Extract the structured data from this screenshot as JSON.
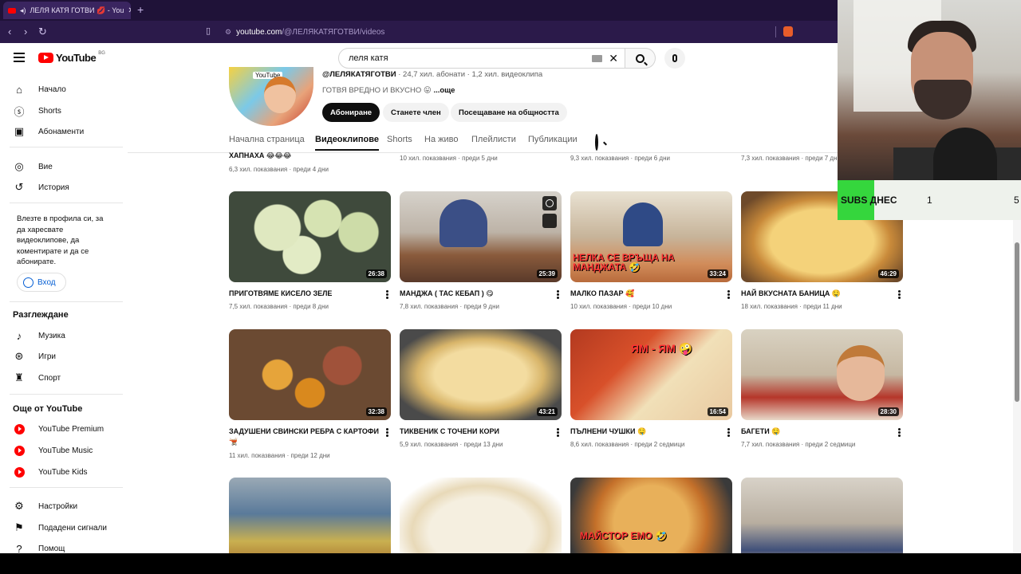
{
  "browser": {
    "tab_title": "ЛЕЛЯ КАТЯ ГОТВИ 💋 - You",
    "url_host": "youtube.com",
    "url_path": "/@ЛЕЛЯКАТЯГОТВИ/videos"
  },
  "masthead": {
    "logo_text": "YouTube",
    "country_code": "BG",
    "search_value": "леля катя"
  },
  "sidebar": {
    "main_items": [
      {
        "label": "Начало",
        "icon": "home-icon"
      },
      {
        "label": "Shorts",
        "icon": "shorts-icon"
      },
      {
        "label": "Абонаменти",
        "icon": "subscriptions-icon"
      }
    ],
    "you_items": [
      {
        "label": "Вие",
        "icon": "user-icon"
      },
      {
        "label": "История",
        "icon": "history-icon"
      }
    ],
    "signin_text": "Влезте в профила си, за да харесвате видеоклипове, да коментирате и да се абонирате.",
    "signin_button": "Вход",
    "explore_heading": "Разглеждане",
    "explore_items": [
      {
        "label": "Музика",
        "icon": "music-icon"
      },
      {
        "label": "Игри",
        "icon": "gaming-icon"
      },
      {
        "label": "Спорт",
        "icon": "trophy-icon"
      }
    ],
    "more_heading": "Още от YouTube",
    "more_items": [
      {
        "label": "YouTube Premium"
      },
      {
        "label": "YouTube Music"
      },
      {
        "label": "YouTube Kids"
      }
    ],
    "bottom_items": [
      {
        "label": "Настройки",
        "icon": "gear-icon"
      },
      {
        "label": "Подадени сигнали",
        "icon": "flag-icon"
      },
      {
        "label": "Помощ",
        "icon": "help-icon"
      }
    ]
  },
  "channel": {
    "avatar_label": "YouTube",
    "handle": "@ЛЕЛЯКАТЯГОТВИ",
    "stats": " · 24,7 хил. абонати · 1,2 хил. видеоклипа",
    "description": "ГОТВЯ ВРЕДНО И ВКУСНО 😛 ",
    "more": "...още",
    "subscribe": "Абониране",
    "join": "Станете член",
    "community": "Посещаване на общността",
    "tabs": [
      "Начална страница",
      "Видеоклипове",
      "Shorts",
      "На живо",
      "Плейлисти",
      "Публикации"
    ]
  },
  "previous_row": [
    {
      "title": "ХАПНАХА 😂😂😂",
      "meta": "6,3 хил. показвания · преди 4 дни"
    },
    {
      "meta": "10 хил. показвания · преди 5 дни"
    },
    {
      "meta": "9,3 хил. показвания · преди 6 дни"
    },
    {
      "meta": "7,3 хил. показвания · преди 7 дни"
    }
  ],
  "videos": [
    {
      "title": "ПРИГОТВЯМЕ КИСЕЛО ЗЕЛЕ",
      "meta": "7,5 хил. показвания · преди 8 дни",
      "duration": "26:38"
    },
    {
      "title": "МАНДЖА ( ТАС КЕБАП ) 😋",
      "meta": "7,8 хил. показвания · преди 9 дни",
      "duration": "25:39"
    },
    {
      "title": "МАЛКО ПАЗАР 🥰",
      "meta": "10 хил. показвания · преди 10 дни",
      "duration": "33:24",
      "overlay": "НЕЛКА СЕ ВРЪЩА НА МАНДЖАТА 🤣"
    },
    {
      "title": "НАЙ ВКУСНАТА БАНИЦА 🤤",
      "meta": "18 хил. показвания · преди 11 дни",
      "duration": "46:29"
    },
    {
      "title": "ЗАДУШЕНИ СВИНСКИ РЕБРА С КАРТОФИ 🫕",
      "meta": "11 хил. показвания · преди 12 дни",
      "duration": "32:38"
    },
    {
      "title": "ТИКВЕНИК С ТОЧЕНИ КОРИ",
      "meta": "5,9 хил. показвания · преди 13 дни",
      "duration": "43:21"
    },
    {
      "title": "ПЪЛНЕНИ ЧУШКИ 🤤",
      "meta": "8,6 хил. показвания · преди 2 седмици",
      "duration": "16:54",
      "overlay": "ЯМ - ЯМ 🤪"
    },
    {
      "title": "БАГЕТИ 🤤",
      "meta": "7,7 хил. показвания · преди 2 седмици",
      "duration": "28:30"
    },
    {
      "overlay": "МАЙСТОР ЕМО 🤣"
    }
  ],
  "overlay_widget": {
    "label": "SUBS ДНЕС",
    "value1": "1",
    "value2": "5"
  }
}
